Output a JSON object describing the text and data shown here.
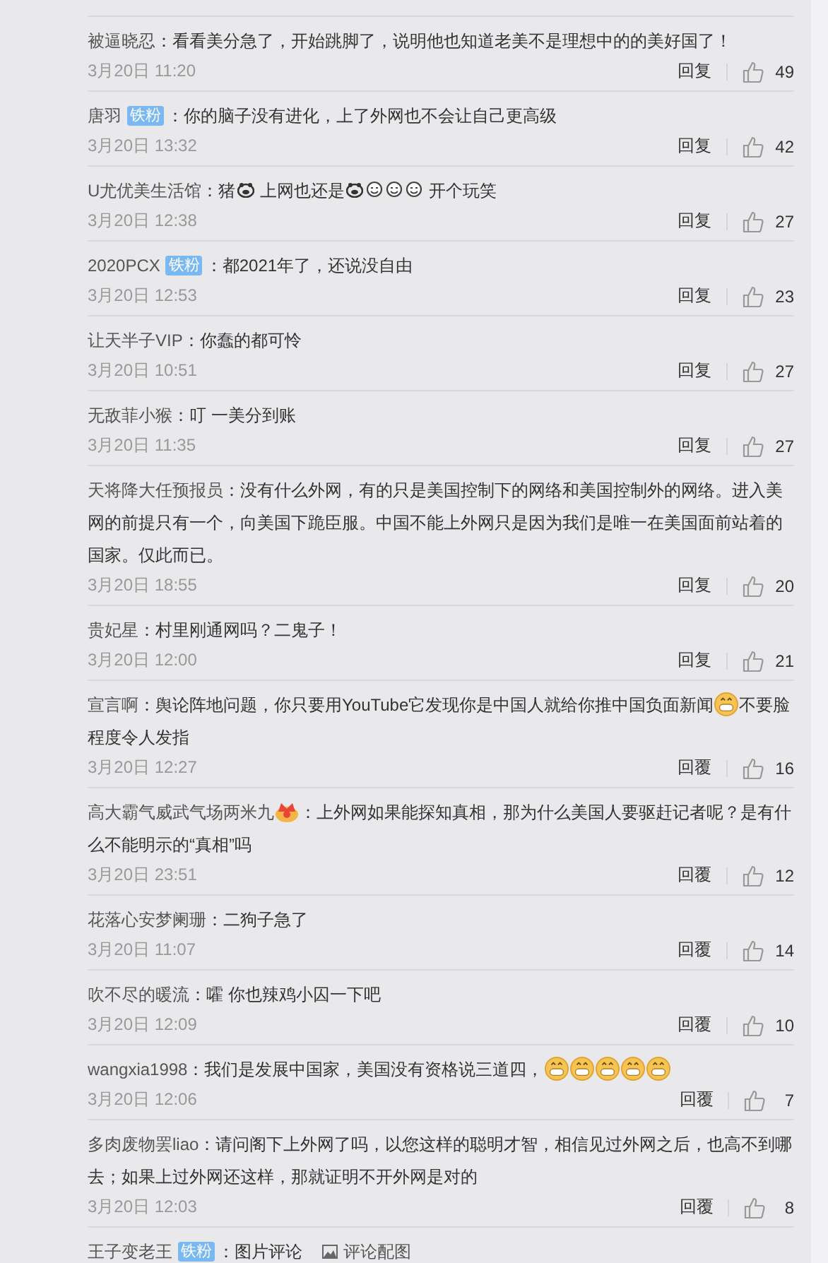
{
  "comments": [
    {
      "user": "被逼晓忍",
      "parts": [
        {
          "kind": "text",
          "text": "：看看美分急了，开始跳脚了，说明他也知道老美不是理想中的的美好国了！"
        }
      ],
      "time": "3月20日 11:20",
      "reply": "回复",
      "likes": "49"
    },
    {
      "user": "唐羽",
      "badge": "铁粉",
      "parts": [
        {
          "kind": "text",
          "text": "：你的脑子没有进化，上了外网也不会让自己更高级"
        }
      ],
      "time": "3月20日 13:32",
      "reply": "回复",
      "likes": "42"
    },
    {
      "user": "U尤优美生活馆",
      "parts": [
        {
          "kind": "text",
          "text": "：猪"
        },
        {
          "kind": "pig"
        },
        {
          "kind": "text",
          "text": " 上网也还是"
        },
        {
          "kind": "pig"
        },
        {
          "kind": "face"
        },
        {
          "kind": "face"
        },
        {
          "kind": "face"
        },
        {
          "kind": "text",
          "text": " 开个玩笑"
        }
      ],
      "time": "3月20日 12:38",
      "reply": "回复",
      "likes": "27"
    },
    {
      "user": "2020PCX",
      "badge": "铁粉",
      "parts": [
        {
          "kind": "text",
          "text": "：都2021年了，还说没自由"
        }
      ],
      "time": "3月20日 12:53",
      "reply": "回复",
      "likes": "23"
    },
    {
      "user": "让天半子VIP",
      "parts": [
        {
          "kind": "text",
          "text": "：你蠢的都可怜"
        }
      ],
      "time": "3月20日 10:51",
      "reply": "回复",
      "likes": "27"
    },
    {
      "user": "无敌菲小猴",
      "parts": [
        {
          "kind": "text",
          "text": "：叮 一美分到账"
        }
      ],
      "time": "3月20日 11:35",
      "reply": "回复",
      "likes": "27"
    },
    {
      "user": "天将降大任预报员",
      "parts": [
        {
          "kind": "text",
          "text": "：没有什么外网，有的只是美国控制下的网络和美国控制外的网络。进入美网的前提只有一个，向美国下跪臣服。中国不能上外网只是因为我们是唯一在美国面前站着的国家。仅此而已。"
        }
      ],
      "time": "3月20日 18:55",
      "reply": "回复",
      "likes": "20"
    },
    {
      "user": "贵妃星",
      "parts": [
        {
          "kind": "text",
          "text": "：村里刚通网吗？二鬼子！"
        }
      ],
      "time": "3月20日 12:00",
      "reply": "回复",
      "likes": "21"
    },
    {
      "user": "宣言啊",
      "parts": [
        {
          "kind": "text",
          "text": "：舆论阵地问题，你只要用YouTube它发现你是中国人就给你推中国负面新闻"
        },
        {
          "kind": "grin"
        },
        {
          "kind": "text",
          "text": "不要脸程度令人发指"
        }
      ],
      "time": "3月20日 12:27",
      "reply": "回覆",
      "likes": "16"
    },
    {
      "user": "高大霸气威武气场两米九",
      "parts": [
        {
          "kind": "crown"
        },
        {
          "kind": "text",
          "text": "：上外网如果能探知真相，那为什么美国人要驱赶记者呢？是有什么不能明示的“真相”吗"
        }
      ],
      "time": "3月20日 23:51",
      "reply": "回覆",
      "likes": "12"
    },
    {
      "user": "花落心安梦阑珊",
      "parts": [
        {
          "kind": "text",
          "text": "：二狗子急了"
        }
      ],
      "time": "3月20日 11:07",
      "reply": "回覆",
      "likes": "14"
    },
    {
      "user": "吹不尽的暖流",
      "parts": [
        {
          "kind": "text",
          "text": "：嚯 你也辣鸡小囚一下吧"
        }
      ],
      "time": "3月20日 12:09",
      "reply": "回覆",
      "likes": "10"
    },
    {
      "user": "wangxia1998",
      "parts": [
        {
          "kind": "text",
          "text": "：我们是发展中国家，美国没有资格说三道四，"
        },
        {
          "kind": "grin"
        },
        {
          "kind": "grin"
        },
        {
          "kind": "grin"
        },
        {
          "kind": "grin"
        },
        {
          "kind": "grin"
        }
      ],
      "time": "3月20日 12:06",
      "reply": "回覆",
      "likes": "7"
    },
    {
      "user": "多肉废物罢liao",
      "parts": [
        {
          "kind": "text",
          "text": "：请问阁下上外网了吗，以您这样的聪明才智，相信见过外网之后，也高不到哪去；如果上过外网还这样，那就证明不开外网是对的"
        }
      ],
      "time": "3月20日 12:03",
      "reply": "回覆",
      "likes": "8"
    },
    {
      "user": "王子变老王",
      "badge": "铁粉",
      "parts": [
        {
          "kind": "text",
          "text": "：图片评论"
        },
        {
          "kind": "image_link",
          "text": "评论配图"
        }
      ]
    }
  ]
}
